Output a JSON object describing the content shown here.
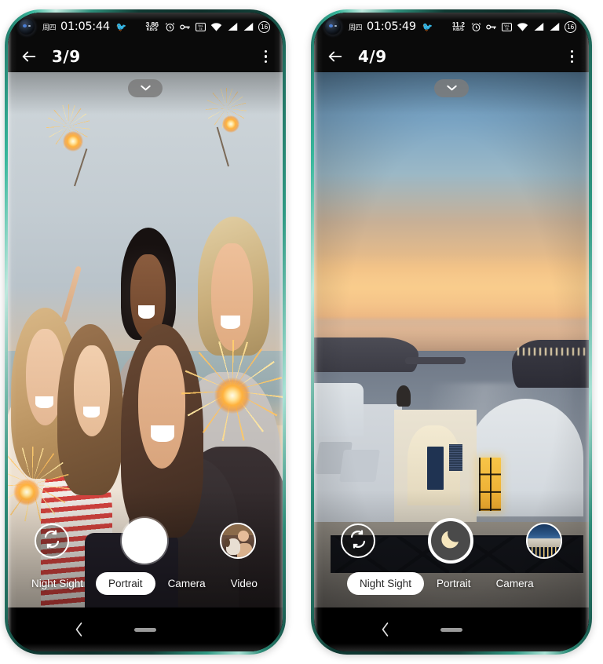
{
  "phones": [
    {
      "id": "phone-left",
      "status_bar": {
        "day": "周四",
        "clock": "01:05:44",
        "emoji": "🐦",
        "net_speed_value": "3.86",
        "net_speed_unit": "KB/S",
        "alarm_icon": "alarm-icon",
        "vpn_icon": "vpn-key-icon",
        "volte_icon": "volte-icon",
        "wifi_icon": "wifi-icon",
        "signal1_icon": "signal-bars-icon",
        "signal2_icon": "signal-bars-icon",
        "battery_percent": "16"
      },
      "app_bar": {
        "back_icon": "back-arrow-icon",
        "title": "3/9",
        "menu_icon": "overflow-menu-icon"
      },
      "viewfinder": {
        "expand_icon": "chevron-down-icon",
        "scene": "group of five friends holding sparklers on a beach at dusk"
      },
      "controls": {
        "flip_icon": "camera-flip-icon",
        "shutter_icon": "shutter-button",
        "shutter_style": "portrait",
        "thumbnail_icon": "gallery-thumbnail",
        "thumbnail_scene": "woman holding a dog"
      },
      "modes": [
        {
          "label": "Night Sight",
          "active": false
        },
        {
          "label": "Portrait",
          "active": true
        },
        {
          "label": "Camera",
          "active": false
        },
        {
          "label": "Video",
          "active": false
        }
      ],
      "nav_bar": {
        "back_icon": "nav-back-icon",
        "home_icon": "nav-home-indicator"
      }
    },
    {
      "id": "phone-right",
      "status_bar": {
        "day": "周四",
        "clock": "01:05:49",
        "emoji": "🐦",
        "net_speed_value": "11.2",
        "net_speed_unit": "KB/S",
        "alarm_icon": "alarm-icon",
        "vpn_icon": "vpn-key-icon",
        "volte_icon": "volte-icon",
        "wifi_icon": "wifi-icon",
        "signal1_icon": "signal-bars-icon",
        "signal2_icon": "signal-bars-icon",
        "battery_percent": "16"
      },
      "app_bar": {
        "back_icon": "back-arrow-icon",
        "title": "4/9",
        "menu_icon": "overflow-menu-icon"
      },
      "viewfinder": {
        "expand_icon": "chevron-down-icon",
        "scene": "Santorini caldera sunset over the sea with white cliffside buildings"
      },
      "controls": {
        "flip_icon": "camera-flip-icon",
        "shutter_icon": "moon-icon",
        "shutter_style": "night",
        "thumbnail_icon": "gallery-thumbnail",
        "thumbnail_scene": "night cityscape"
      },
      "modes": [
        {
          "label": "Night Sight",
          "active": true
        },
        {
          "label": "Portrait",
          "active": false
        },
        {
          "label": "Camera",
          "active": false
        }
      ],
      "nav_bar": {
        "back_icon": "nav-back-icon",
        "home_icon": "nav-home-indicator"
      }
    }
  ],
  "colors": {
    "frame": "#2d9a84",
    "status_bg": "#0a0a0a",
    "active_pill": "#ffffff",
    "active_pill_text": "#262626",
    "shutter_night_bg": "#4a4a4a",
    "moon": "#f5e6bd",
    "home_indicator": "#9a9a9a"
  }
}
